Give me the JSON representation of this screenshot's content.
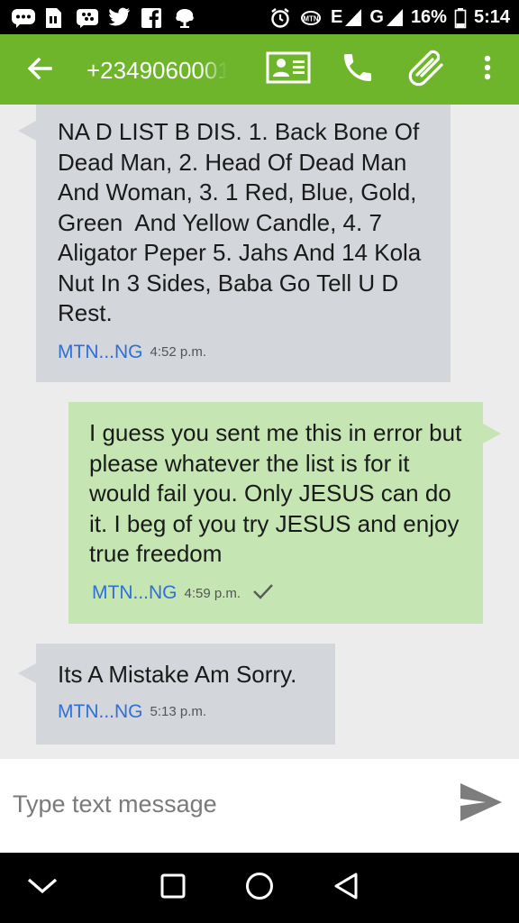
{
  "status_bar": {
    "battery": "16%",
    "time": "5:14",
    "network_label": "E",
    "network_label_2": "G",
    "left_icons": [
      "chat-bubble-icon",
      "sim-card-icon",
      "blackberry-messenger-icon",
      "twitter-icon",
      "facebook-icon",
      "tree-icon"
    ],
    "right_icons": [
      "alarm-icon",
      "mtn-logo-icon",
      "signal-icon",
      "signal-icon",
      "battery-icon"
    ]
  },
  "app_bar": {
    "title": "+2349060001",
    "icons": [
      "back-arrow-icon",
      "contact-card-icon",
      "phone-icon",
      "paperclip-icon",
      "overflow-menu-icon"
    ],
    "color": "#6fb52c"
  },
  "messages": [
    {
      "direction": "incoming",
      "text": "NA D LIST B DIS. 1. Back Bone Of Dead Man, 2. Head Of Dead Man And Woman, 3. 1 Red, Blue, Gold, Green  And Yellow Candle, 4. 7 Aligator Peper 5. Jahs And 14 Kola Nut In 3 Sides, Baba Go Tell U D Rest.",
      "carrier": "MTN...NG",
      "time": "4:52 p.m."
    },
    {
      "direction": "outgoing",
      "text": "I guess you sent me this in error but please whatever the list is for it would fail you. Only JESUS can do it. I beg of you try JESUS and enjoy true freedom",
      "carrier": "MTN...NG",
      "time": "4:59 p.m.",
      "status_icon": "checkmark-icon"
    },
    {
      "direction": "incoming",
      "text": "Its A Mistake Am Sorry.",
      "carrier": "MTN...NG",
      "time": "5:13 p.m."
    }
  ],
  "compose": {
    "placeholder": "Type text message",
    "send_icon": "send-icon"
  },
  "nav_bar": {
    "icons": [
      "chevron-down-icon",
      "recents-square-icon",
      "home-circle-icon",
      "back-triangle-icon"
    ]
  },
  "colors": {
    "incoming_bubble": "#d3d6da",
    "outgoing_bubble": "#c5e6b3",
    "carrier_link": "#2f6fd6",
    "thread_background": "#ececec"
  }
}
